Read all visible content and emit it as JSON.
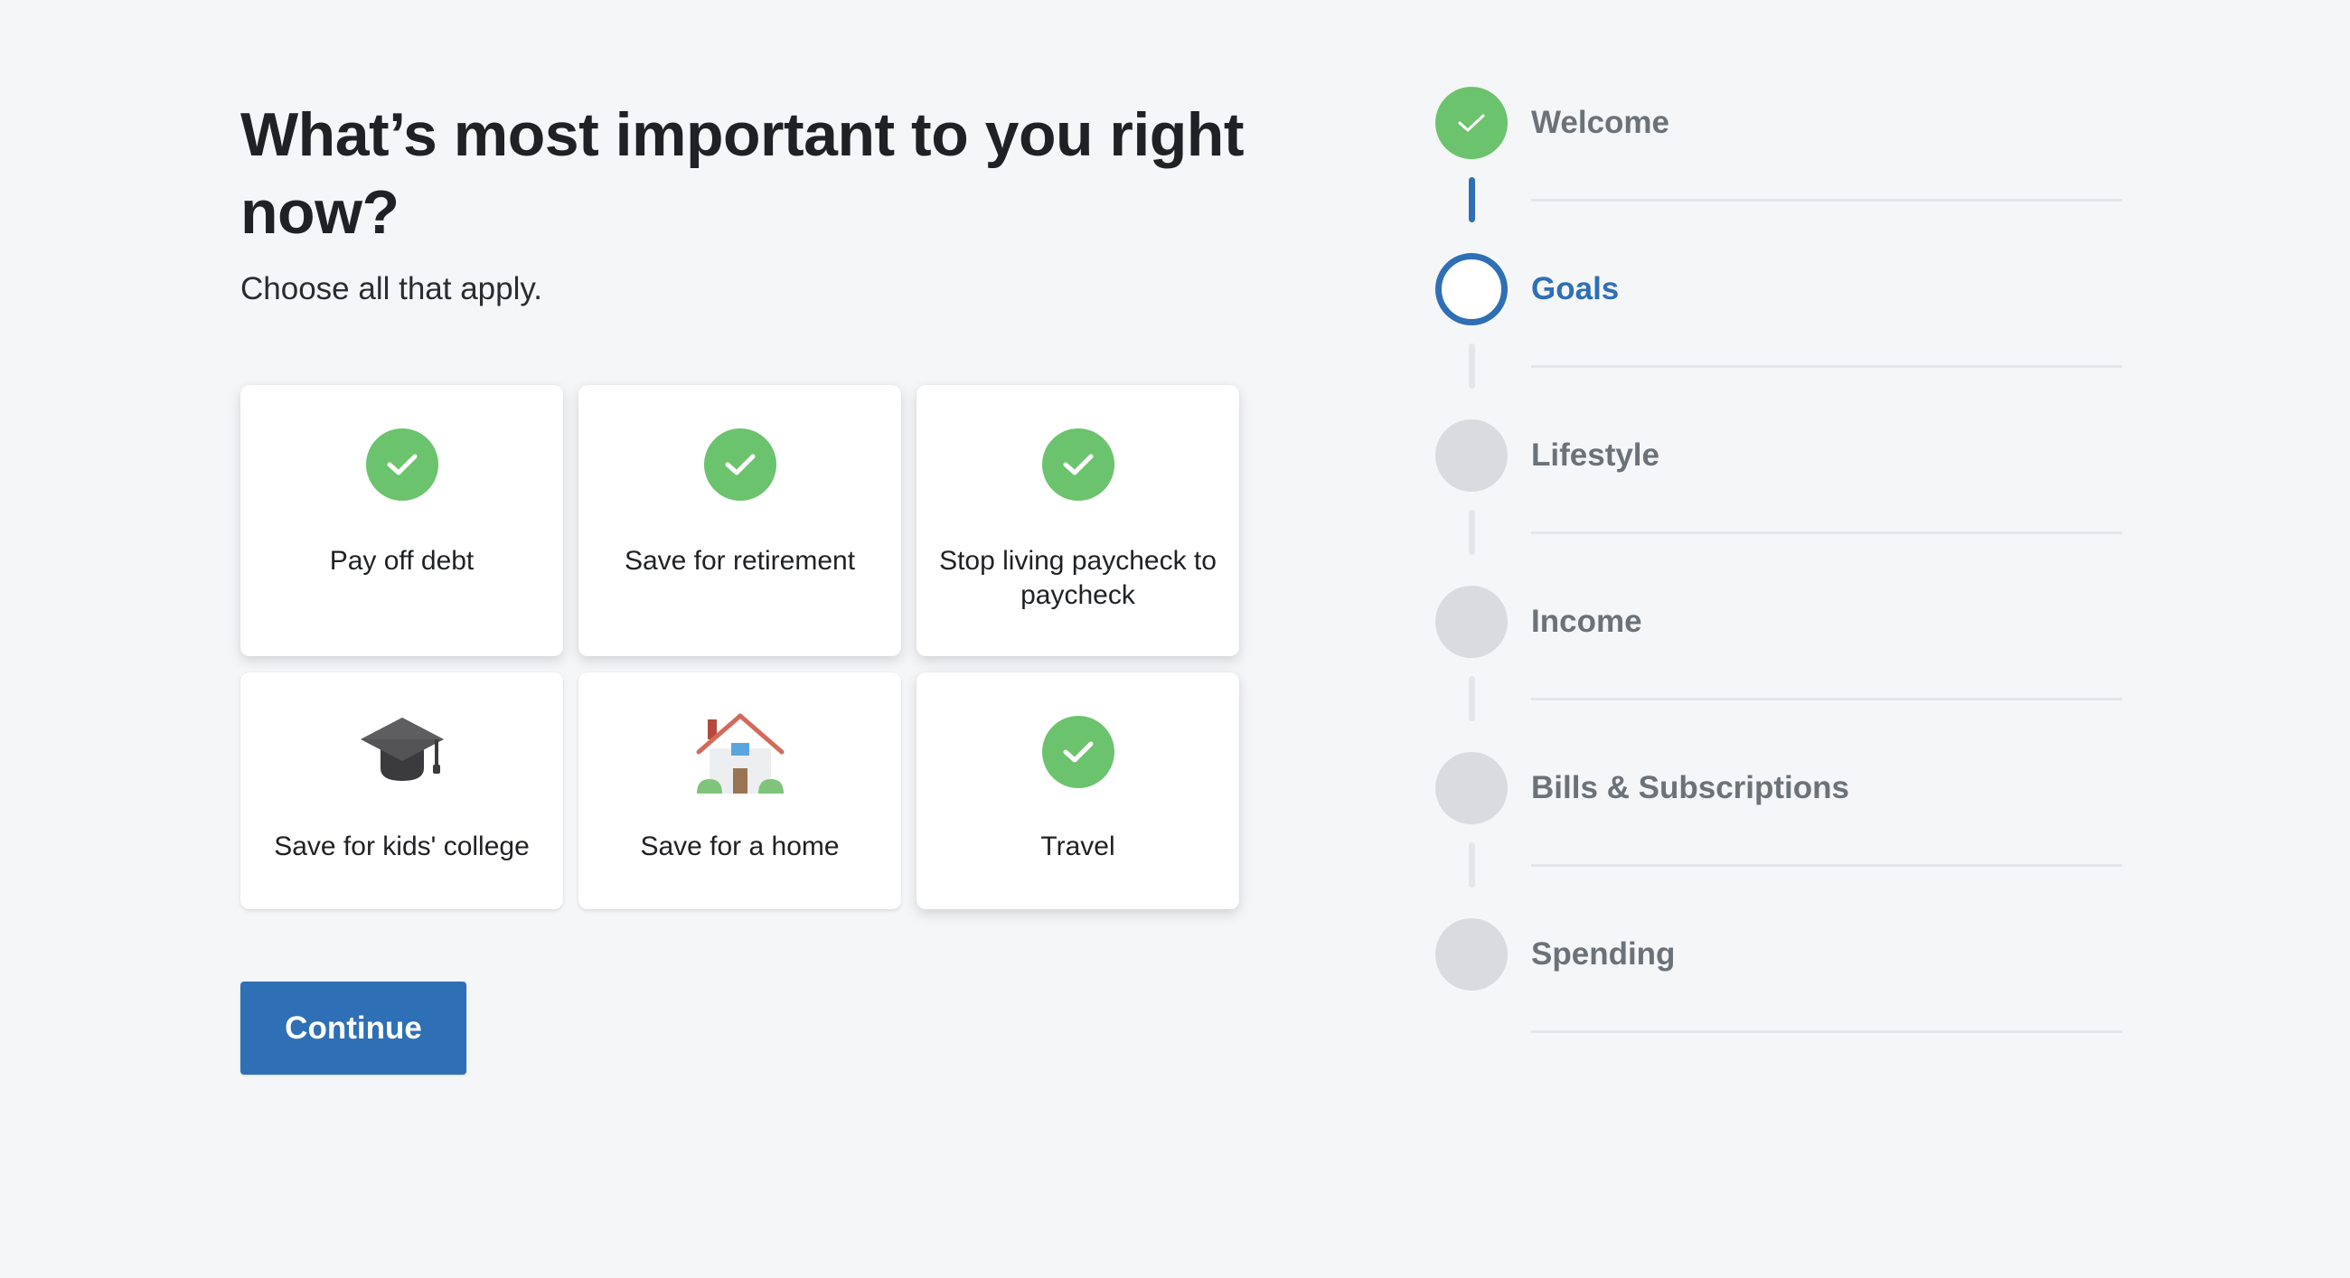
{
  "question": {
    "title": "What’s most important to you right now?",
    "subtitle": "Choose all that apply."
  },
  "goals": [
    {
      "label": "Pay off debt",
      "selected": true,
      "icon": "check-icon"
    },
    {
      "label": "Save for retirement",
      "selected": true,
      "icon": "check-icon"
    },
    {
      "label": "Stop living paycheck to paycheck",
      "selected": true,
      "icon": "check-icon"
    },
    {
      "label": "Save for kids' college",
      "selected": false,
      "icon": "graduation-cap-icon"
    },
    {
      "label": "Save for a home",
      "selected": false,
      "icon": "house-icon"
    },
    {
      "label": "Travel",
      "selected": true,
      "icon": "check-icon"
    }
  ],
  "continue_label": "Continue",
  "steps": [
    {
      "label": "Welcome",
      "status": "done"
    },
    {
      "label": "Goals",
      "status": "current"
    },
    {
      "label": "Lifestyle",
      "status": "upcoming"
    },
    {
      "label": "Income",
      "status": "upcoming"
    },
    {
      "label": "Bills & Subscriptions",
      "status": "upcoming"
    },
    {
      "label": "Spending",
      "status": "upcoming"
    }
  ],
  "colors": {
    "accent": "#2e6fb5",
    "success": "#6cc36d",
    "inactive": "#d9dbde",
    "background": "#f5f6f8"
  }
}
